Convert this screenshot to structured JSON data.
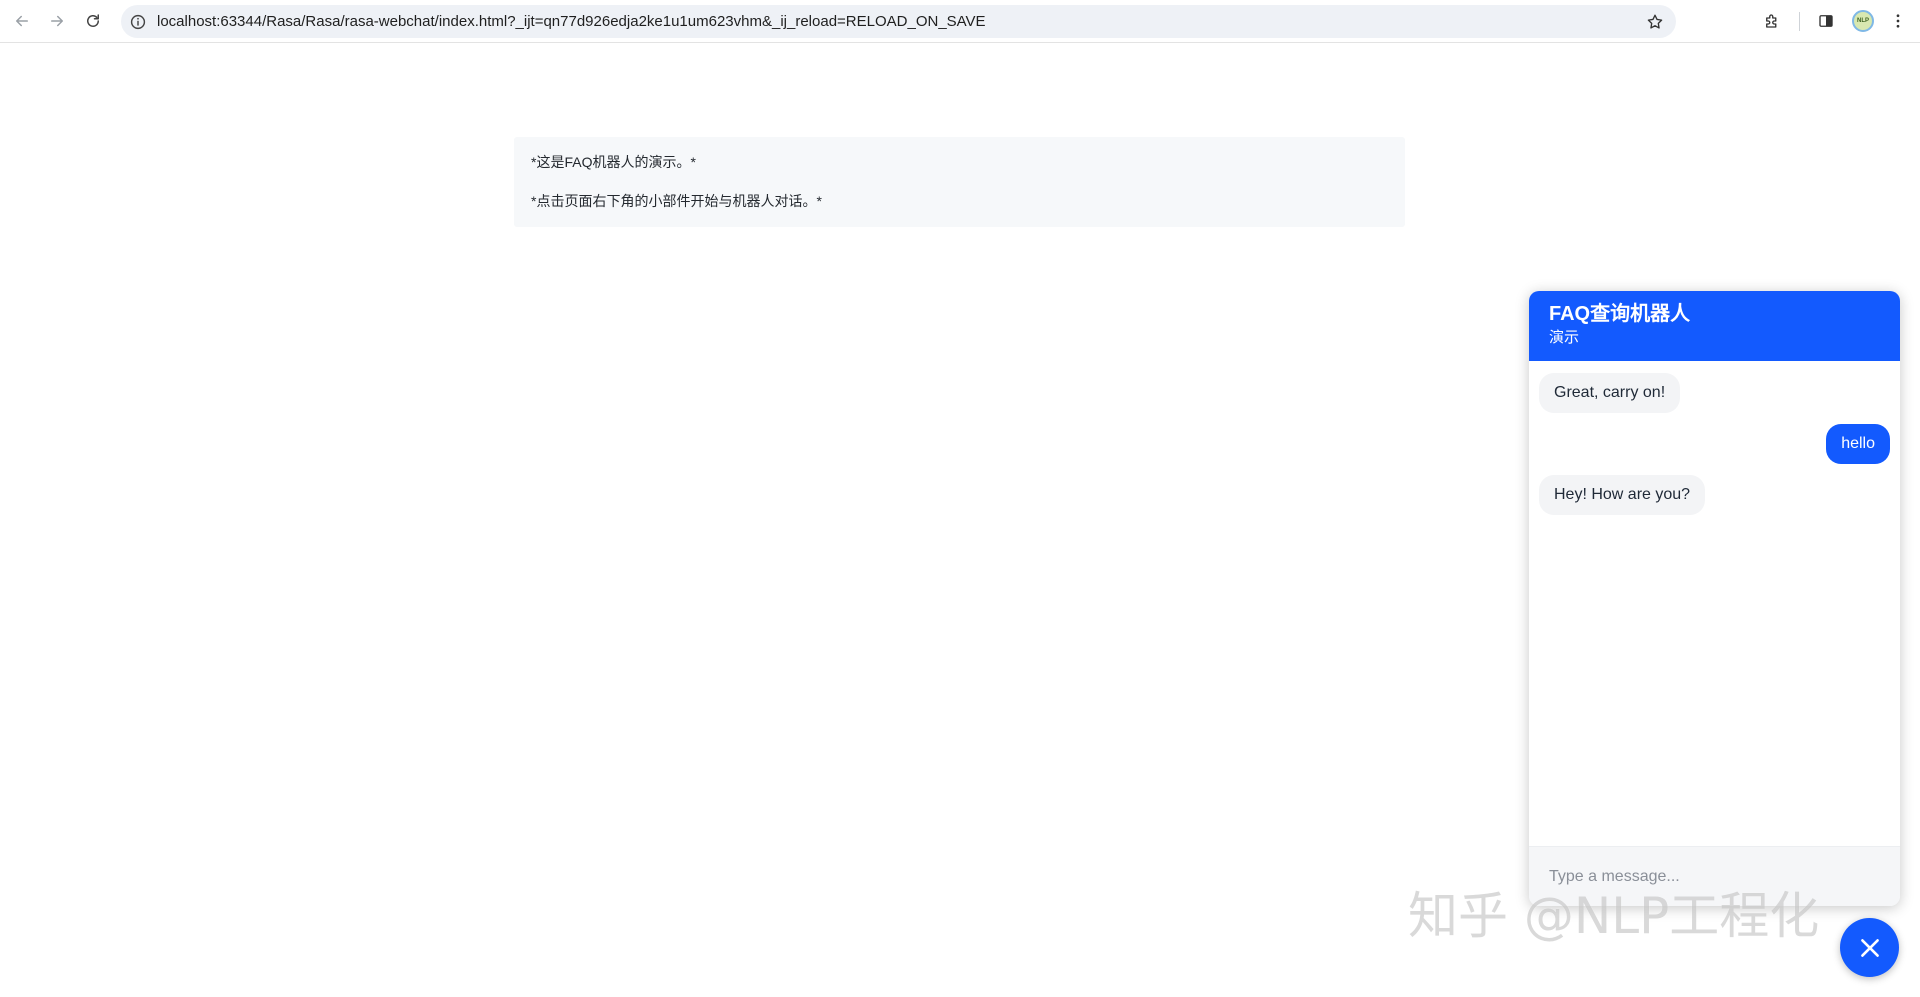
{
  "browser": {
    "url": "localhost:63344/Rasa/Rasa/rasa-webchat/index.html?_ijt=qn77d926edja2ke1u1um623vhm&_ij_reload=RELOAD_ON_SAVE",
    "profile_initials": "NLP",
    "icons": [
      "back-icon",
      "forward-icon",
      "reload-icon",
      "info-icon",
      "star-icon",
      "extensions-icon",
      "side-panel-icon",
      "menu-icon"
    ]
  },
  "intro": {
    "line1": "*这是FAQ机器人的演示。*",
    "line2": "*点击页面右下角的小部件开始与机器人对话。*"
  },
  "chat": {
    "title": "FAQ查询机器人",
    "subtitle": "演示",
    "messages": [
      {
        "sender": "bot",
        "text": "Great, carry on!"
      },
      {
        "sender": "user",
        "text": "hello"
      },
      {
        "sender": "bot",
        "text": "Hey! How are you?"
      }
    ],
    "input_placeholder": "Type a message...",
    "input_value": ""
  },
  "watermark": "知乎 @NLP工程化",
  "colors": {
    "accent": "#135afe",
    "bot_bubble": "#f3f4f6",
    "intro_background": "#f6f8fa"
  }
}
